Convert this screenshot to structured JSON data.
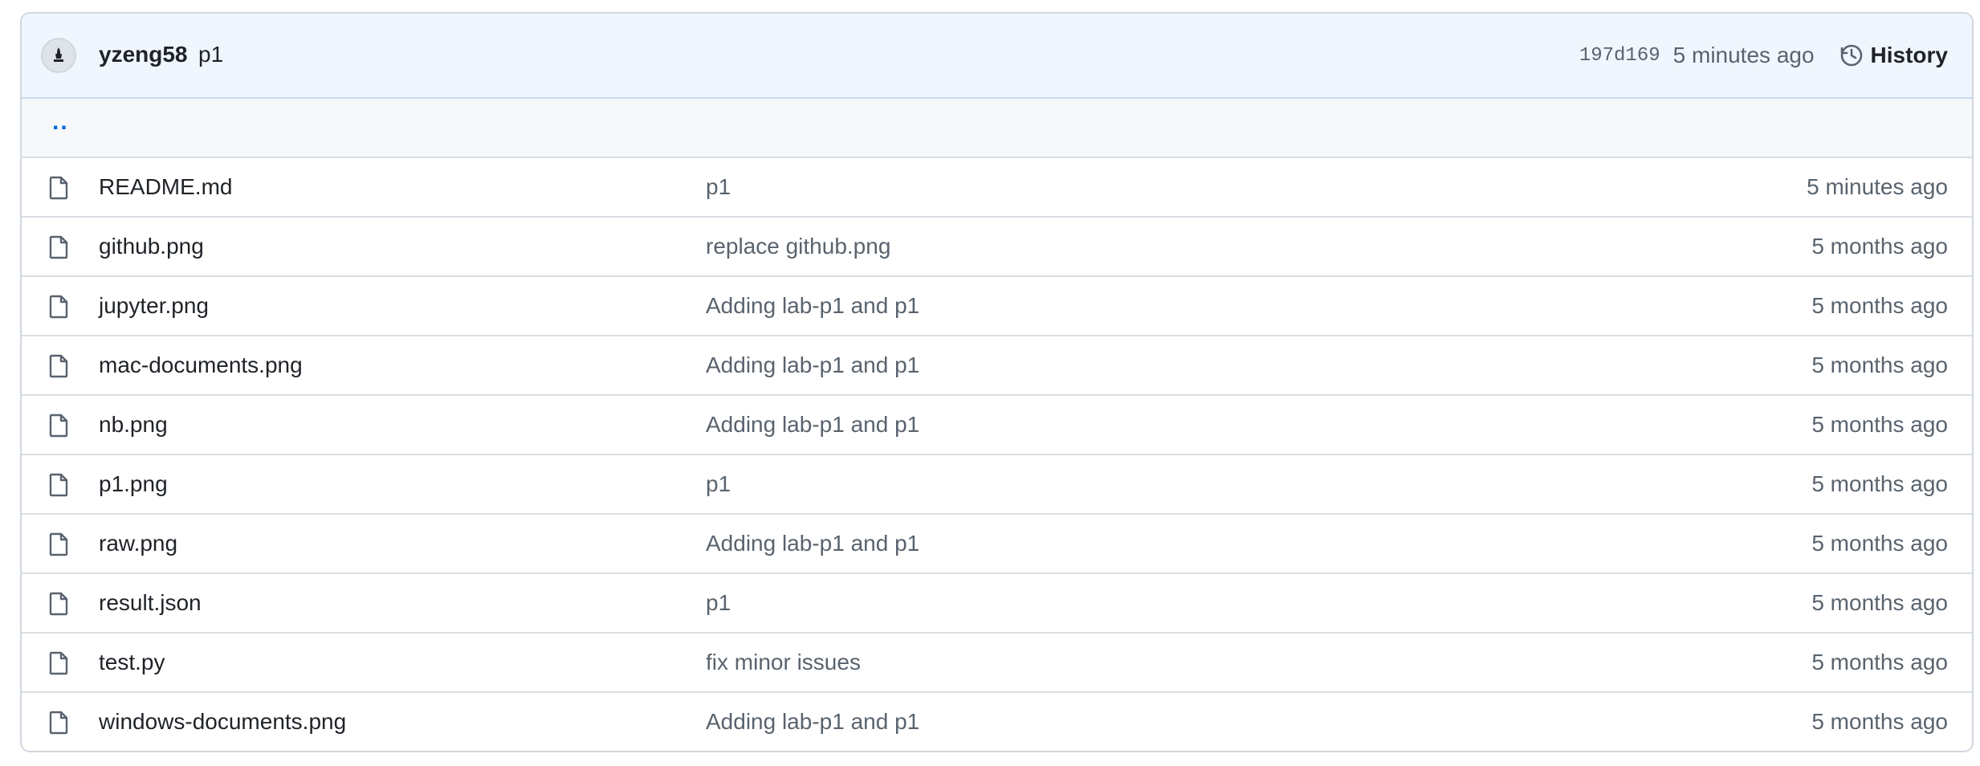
{
  "commit": {
    "author": "yzeng58",
    "message": "p1",
    "sha": "197d169",
    "time": "5 minutes ago",
    "history_label": "History"
  },
  "parent_dir": "..",
  "files": [
    {
      "name": "README.md",
      "commit": "p1",
      "time": "5 minutes ago"
    },
    {
      "name": "github.png",
      "commit": "replace github.png",
      "time": "5 months ago"
    },
    {
      "name": "jupyter.png",
      "commit": "Adding lab-p1 and p1",
      "time": "5 months ago"
    },
    {
      "name": "mac-documents.png",
      "commit": "Adding lab-p1 and p1",
      "time": "5 months ago"
    },
    {
      "name": "nb.png",
      "commit": "Adding lab-p1 and p1",
      "time": "5 months ago"
    },
    {
      "name": "p1.png",
      "commit": "p1",
      "time": "5 months ago"
    },
    {
      "name": "raw.png",
      "commit": "Adding lab-p1 and p1",
      "time": "5 months ago"
    },
    {
      "name": "result.json",
      "commit": "p1",
      "time": "5 months ago"
    },
    {
      "name": "test.py",
      "commit": "fix minor issues",
      "time": "5 months ago"
    },
    {
      "name": "windows-documents.png",
      "commit": "Adding lab-p1 and p1",
      "time": "5 months ago"
    }
  ],
  "icons": {
    "file": "file-icon",
    "history": "history-icon",
    "avatar": "avatar"
  },
  "colors": {
    "header_bg": "#f0f6fd",
    "link": "#0969da",
    "muted": "#59636e",
    "border": "#d0d7de"
  }
}
